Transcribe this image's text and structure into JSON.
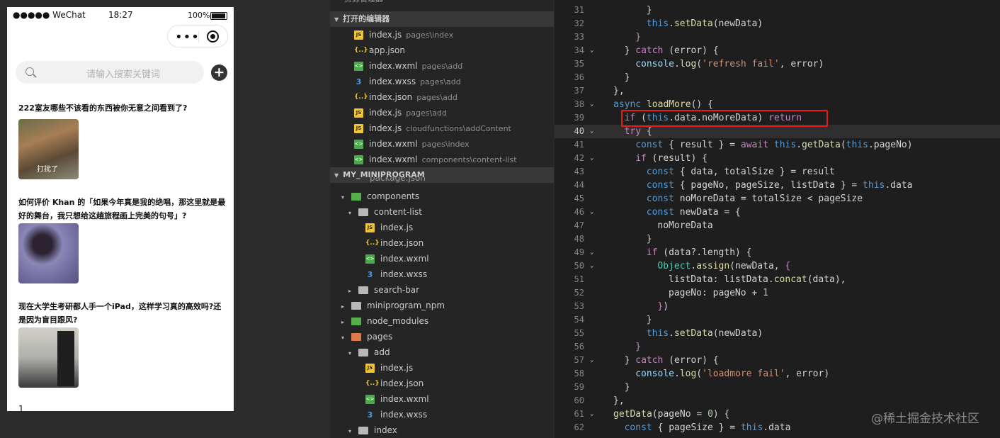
{
  "phone": {
    "status": {
      "carrier": "●●●●● WeChat",
      "time": "18:27",
      "battery": "100%"
    },
    "capsule": {
      "menu": "•••"
    },
    "search": {
      "placeholder": "请输入搜索关键词",
      "add": "+"
    },
    "questions": [
      {
        "title": "222室友哪些不该看的东西被你无意之间看到了?",
        "image_caption": "打扰了"
      },
      {
        "title": "如何评价 Khan 的「如果今年真是我的绝唱，那这里就是最好的舞台，我只想给这趟旅程画上完美的句号」?"
      },
      {
        "title": "现在大学生考研都人手一个iPad，这样学习真的高效吗?还是因为盲目跟风?"
      }
    ],
    "page_number": "1"
  },
  "explorer": {
    "top_label": "资源管理器",
    "open_editors_header": "打开的编辑器",
    "open_editors": [
      {
        "icon": "js",
        "name": "index.js",
        "path": "pages\\index"
      },
      {
        "icon": "json",
        "name": "app.json",
        "path": ""
      },
      {
        "icon": "wxml",
        "name": "index.wxml",
        "path": "pages\\add"
      },
      {
        "icon": "css",
        "name": "index.wxss",
        "path": "pages\\add"
      },
      {
        "icon": "json",
        "name": "index.json",
        "path": "pages\\add"
      },
      {
        "icon": "js",
        "name": "index.js",
        "path": "pages\\add"
      },
      {
        "icon": "js",
        "name": "index.js",
        "path": "cloudfunctions\\addContent"
      },
      {
        "icon": "wxml",
        "name": "index.wxml",
        "path": "pages\\index"
      },
      {
        "icon": "wxml",
        "name": "index.wxml",
        "path": "components\\content-list"
      }
    ],
    "project_header": "MY_MINIPROGRAM",
    "partial_item": "package.json",
    "tree": [
      {
        "caret": "▾",
        "icon": "folder-green",
        "name": "components",
        "depth": 1
      },
      {
        "caret": "▾",
        "icon": "folder",
        "name": "content-list",
        "depth": 2
      },
      {
        "caret": "",
        "icon": "js",
        "name": "index.js",
        "depth": 3
      },
      {
        "caret": "",
        "icon": "json",
        "name": "index.json",
        "depth": 3
      },
      {
        "caret": "",
        "icon": "wxml",
        "name": "index.wxml",
        "depth": 3
      },
      {
        "caret": "",
        "icon": "css",
        "name": "index.wxss",
        "depth": 3
      },
      {
        "caret": "▸",
        "icon": "folder",
        "name": "search-bar",
        "depth": 2
      },
      {
        "caret": "▸",
        "icon": "folder",
        "name": "miniprogram_npm",
        "depth": 1
      },
      {
        "caret": "▸",
        "icon": "folder-green",
        "name": "node_modules",
        "depth": 1
      },
      {
        "caret": "▾",
        "icon": "folder-red",
        "name": "pages",
        "depth": 1
      },
      {
        "caret": "▾",
        "icon": "folder",
        "name": "add",
        "depth": 2
      },
      {
        "caret": "",
        "icon": "js",
        "name": "index.js",
        "depth": 3
      },
      {
        "caret": "",
        "icon": "json",
        "name": "index.json",
        "depth": 3
      },
      {
        "caret": "",
        "icon": "wxml",
        "name": "index.wxml",
        "depth": 3
      },
      {
        "caret": "",
        "icon": "css",
        "name": "index.wxss",
        "depth": 3
      },
      {
        "caret": "▾",
        "icon": "folder",
        "name": "index",
        "depth": 2
      }
    ]
  },
  "editor": {
    "current_line": 40,
    "highlighted_line": 39,
    "lines": [
      {
        "n": 31,
        "fold": "",
        "indent": 6,
        "tokens": [
          [
            "p",
            "}"
          ]
        ]
      },
      {
        "n": 32,
        "fold": "",
        "indent": 6,
        "tokens": [
          [
            "kw",
            "this"
          ],
          [
            "p",
            "."
          ],
          [
            "f",
            "setData"
          ],
          [
            "p",
            "(newData)"
          ]
        ]
      },
      {
        "n": 33,
        "fold": "",
        "indent": 4,
        "tokens": [
          [
            "k",
            "}"
          ]
        ]
      },
      {
        "n": 34,
        "fold": "⌄",
        "indent": 2,
        "tokens": [
          [
            "p",
            "} "
          ],
          [
            "k",
            "catch"
          ],
          [
            "p",
            " (error) {"
          ]
        ]
      },
      {
        "n": 35,
        "fold": "",
        "indent": 4,
        "tokens": [
          [
            "v",
            "console"
          ],
          [
            "p",
            "."
          ],
          [
            "f",
            "log"
          ],
          [
            "p",
            "("
          ],
          [
            "s",
            "'refresh fail'"
          ],
          [
            "p",
            ", error)"
          ]
        ]
      },
      {
        "n": 36,
        "fold": "",
        "indent": 2,
        "tokens": [
          [
            "p",
            "}"
          ]
        ]
      },
      {
        "n": 37,
        "fold": "",
        "indent": 0,
        "tokens": [
          [
            "p",
            "},"
          ]
        ]
      },
      {
        "n": 38,
        "fold": "⌄",
        "indent": 0,
        "tokens": [
          [
            "kw",
            "async"
          ],
          [
            "p",
            " "
          ],
          [
            "f",
            "loadMore"
          ],
          [
            "p",
            "() {"
          ]
        ]
      },
      {
        "n": 39,
        "fold": "",
        "indent": 2,
        "tokens": [
          [
            "k",
            "if"
          ],
          [
            "p",
            " ("
          ],
          [
            "kw",
            "this"
          ],
          [
            "p",
            ".data.noMoreData) "
          ],
          [
            "k",
            "return"
          ]
        ]
      },
      {
        "n": 40,
        "fold": "⌄",
        "indent": 2,
        "tokens": [
          [
            "k",
            "try"
          ],
          [
            "p",
            " {"
          ]
        ]
      },
      {
        "n": 41,
        "fold": "",
        "indent": 4,
        "tokens": [
          [
            "kw",
            "const"
          ],
          [
            "p",
            " { result } = "
          ],
          [
            "k",
            "await"
          ],
          [
            "p",
            " "
          ],
          [
            "kw",
            "this"
          ],
          [
            "p",
            "."
          ],
          [
            "f",
            "getData"
          ],
          [
            "p",
            "("
          ],
          [
            "kw",
            "this"
          ],
          [
            "p",
            ".pageNo)"
          ]
        ]
      },
      {
        "n": 42,
        "fold": "⌄",
        "indent": 4,
        "tokens": [
          [
            "k",
            "if"
          ],
          [
            "p",
            " (result) {"
          ]
        ]
      },
      {
        "n": 43,
        "fold": "",
        "indent": 6,
        "tokens": [
          [
            "kw",
            "const"
          ],
          [
            "p",
            " { data, totalSize } = result"
          ]
        ]
      },
      {
        "n": 44,
        "fold": "",
        "indent": 6,
        "tokens": [
          [
            "kw",
            "const"
          ],
          [
            "p",
            " { pageNo, pageSize, listData } = "
          ],
          [
            "kw",
            "this"
          ],
          [
            "p",
            ".data"
          ]
        ]
      },
      {
        "n": 45,
        "fold": "",
        "indent": 6,
        "tokens": [
          [
            "kw",
            "const"
          ],
          [
            "p",
            " noMoreData = totalSize < pageSize"
          ]
        ]
      },
      {
        "n": 46,
        "fold": "⌄",
        "indent": 6,
        "tokens": [
          [
            "kw",
            "const"
          ],
          [
            "p",
            " newData = {"
          ]
        ]
      },
      {
        "n": 47,
        "fold": "",
        "indent": 8,
        "tokens": [
          [
            "p",
            "noMoreData"
          ]
        ]
      },
      {
        "n": 48,
        "fold": "",
        "indent": 6,
        "tokens": [
          [
            "p",
            "}"
          ]
        ]
      },
      {
        "n": 49,
        "fold": "⌄",
        "indent": 6,
        "tokens": [
          [
            "k",
            "if"
          ],
          [
            "p",
            " (data?.length) {"
          ]
        ]
      },
      {
        "n": 50,
        "fold": "⌄",
        "indent": 8,
        "tokens": [
          [
            "t",
            "Object"
          ],
          [
            "p",
            "."
          ],
          [
            "f",
            "assign"
          ],
          [
            "p",
            "(newData, "
          ],
          [
            "k",
            "{"
          ]
        ]
      },
      {
        "n": 51,
        "fold": "",
        "indent": 10,
        "tokens": [
          [
            "p",
            "listData: listData."
          ],
          [
            "f",
            "concat"
          ],
          [
            "p",
            "(data),"
          ]
        ]
      },
      {
        "n": 52,
        "fold": "",
        "indent": 10,
        "tokens": [
          [
            "p",
            "pageNo: pageNo + "
          ],
          [
            "n",
            "1"
          ]
        ]
      },
      {
        "n": 53,
        "fold": "",
        "indent": 8,
        "tokens": [
          [
            "k",
            "}"
          ],
          [
            "p",
            ")"
          ]
        ]
      },
      {
        "n": 54,
        "fold": "",
        "indent": 6,
        "tokens": [
          [
            "p",
            "}"
          ]
        ]
      },
      {
        "n": 55,
        "fold": "",
        "indent": 6,
        "tokens": [
          [
            "kw",
            "this"
          ],
          [
            "p",
            "."
          ],
          [
            "f",
            "setData"
          ],
          [
            "p",
            "(newData)"
          ]
        ]
      },
      {
        "n": 56,
        "fold": "",
        "indent": 4,
        "tokens": [
          [
            "k",
            "}"
          ]
        ]
      },
      {
        "n": 57,
        "fold": "⌄",
        "indent": 2,
        "tokens": [
          [
            "p",
            "} "
          ],
          [
            "k",
            "catch"
          ],
          [
            "p",
            " (error) {"
          ]
        ]
      },
      {
        "n": 58,
        "fold": "",
        "indent": 4,
        "tokens": [
          [
            "v",
            "console"
          ],
          [
            "p",
            "."
          ],
          [
            "f",
            "log"
          ],
          [
            "p",
            "("
          ],
          [
            "s",
            "'loadmore fail'"
          ],
          [
            "p",
            ", error)"
          ]
        ]
      },
      {
        "n": 59,
        "fold": "",
        "indent": 2,
        "tokens": [
          [
            "p",
            "}"
          ]
        ]
      },
      {
        "n": 60,
        "fold": "",
        "indent": 0,
        "tokens": [
          [
            "p",
            "},"
          ]
        ]
      },
      {
        "n": 61,
        "fold": "⌄",
        "indent": 0,
        "tokens": [
          [
            "f",
            "getData"
          ],
          [
            "p",
            "(pageNo = "
          ],
          [
            "n",
            "0"
          ],
          [
            "p",
            ") {"
          ]
        ]
      },
      {
        "n": 62,
        "fold": "",
        "indent": 2,
        "tokens": [
          [
            "kw",
            "const"
          ],
          [
            "p",
            " { pageSize } = "
          ],
          [
            "kw",
            "this"
          ],
          [
            "p",
            ".data"
          ]
        ]
      }
    ],
    "watermark": "@稀土掘金技术社区"
  },
  "colors": {
    "accent_highlight": "#e51c1c",
    "editor_bg": "#1e1e1e",
    "explorer_bg": "#252526"
  }
}
